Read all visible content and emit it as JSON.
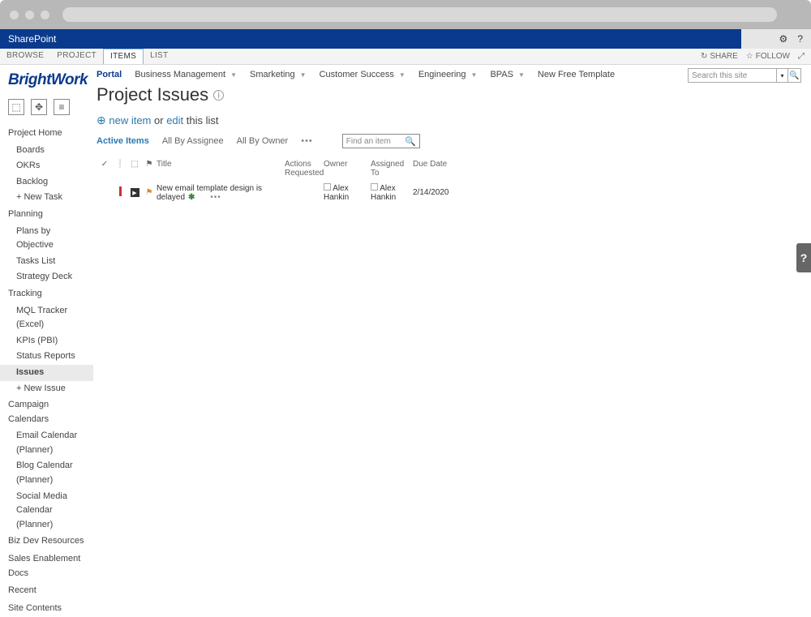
{
  "sharepoint_label": "SharePoint",
  "ribbon": {
    "tabs": [
      "BROWSE",
      "PROJECT",
      "ITEMS",
      "LIST"
    ],
    "active": 2,
    "share": "SHARE",
    "follow": "FOLLOW"
  },
  "logo": "BrightWork",
  "top_nav": {
    "portal": "Portal",
    "items": [
      "Business Management",
      "Smarketing",
      "Customer Success",
      "Engineering",
      "BPAS",
      "New Free Template"
    ]
  },
  "search": {
    "placeholder": "Search this site"
  },
  "page_title": "Project Issues",
  "new_item": {
    "prefix": "new item",
    "mid": " or ",
    "edit": "edit",
    "suffix": " this list"
  },
  "views": {
    "items": [
      "Active Items",
      "All By Assignee",
      "All By Owner"
    ],
    "active": 0
  },
  "find": {
    "placeholder": "Find an item"
  },
  "columns": {
    "title": "Title",
    "actions": "Actions Requested",
    "owner": "Owner",
    "assigned": "Assigned To",
    "due": "Due Date"
  },
  "rows": [
    {
      "title": "New email template design is delayed",
      "badge": "✱",
      "owner": "Alex Hankin",
      "assigned": "Alex Hankin",
      "due": "2/14/2020"
    }
  ],
  "sidebar": {
    "project_home": "Project Home",
    "ph_items": [
      "Boards",
      "OKRs",
      "Backlog",
      "+ New Task"
    ],
    "planning": "Planning",
    "pl_items": [
      "Plans by Objective",
      "Tasks List",
      "Strategy Deck"
    ],
    "tracking": "Tracking",
    "tr_items": [
      "MQL Tracker (Excel)",
      "KPIs (PBI)",
      "Status Reports",
      "Issues",
      "+ New Issue"
    ],
    "calendars": "Campaign Calendars",
    "cal_items": [
      "Email Calendar (Planner)",
      "Blog Calendar (Planner)",
      "Social Media Calendar (Planner)"
    ],
    "footer": [
      "Biz Dev Resources",
      "Sales Enablement Docs",
      "Recent",
      "Site Contents"
    ]
  }
}
